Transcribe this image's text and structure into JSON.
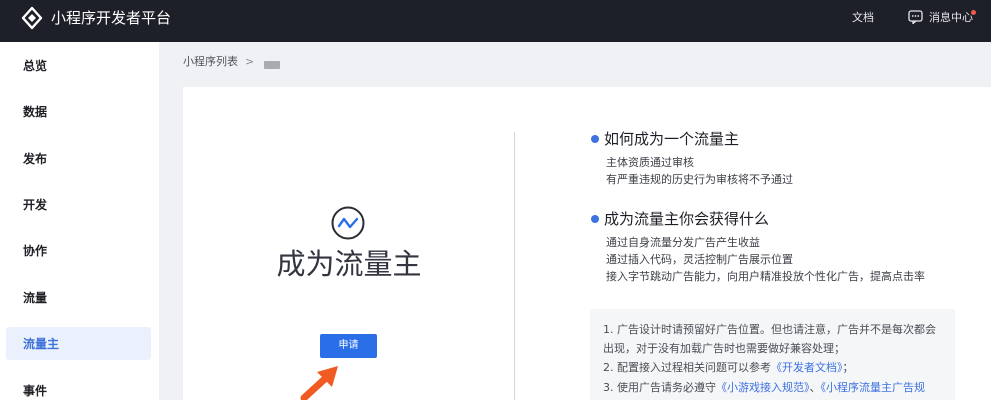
{
  "topbar": {
    "app_title": "小程序开发者平台",
    "doc_link": "文档",
    "messages_link": "消息中心"
  },
  "sidebar": {
    "items": [
      {
        "label": "总览"
      },
      {
        "label": "数据"
      },
      {
        "label": "发布"
      },
      {
        "label": "开发"
      },
      {
        "label": "协作"
      },
      {
        "label": "流量"
      },
      {
        "label": "流量主",
        "active": true
      },
      {
        "label": "事件"
      }
    ]
  },
  "breadcrumb": {
    "root": "小程序列表",
    "separator": ">"
  },
  "hero": {
    "title": "成为流量主",
    "apply_button": "申请"
  },
  "sections": [
    {
      "heading": "如何成为一个流量主",
      "lines": [
        "主体资质通过审核",
        "有严重违规的历史行为审核将不予通过"
      ]
    },
    {
      "heading": "成为流量主你会获得什么",
      "lines": [
        "通过自身流量分发广告产生收益",
        "通过插入代码，灵活控制广告展示位置",
        "接入字节跳动广告能力，向用户精准投放个性化广告，提高点击率"
      ]
    }
  ],
  "notes": {
    "line1": "1. 广告设计时请预留好广告位置。但也请注意，广告并不是每次都会",
    "line2": "出现，对于没有加载广告时也需要做好兼容处理；",
    "line3_prefix": "2. 配置接入过程相关问题可以参考",
    "line3_link": "《开发者文档》",
    "line3_suffix": "；",
    "line4_prefix": "3. 使用广告请务必遵守",
    "line4_link1": "《小游戏接入规范》",
    "line4_sep": "、",
    "line4_link2": "《小程序流量主广告规"
  },
  "colors": {
    "accent": "#2a6ee8",
    "topbar": "#1e2029",
    "sidebar_active_bg": "#eaf0fc",
    "sidebar_active_text": "#3e72d8",
    "arrow": "#f05b24",
    "notification_dot": "#f05a4a"
  },
  "icons": [
    "logo-icon",
    "message-icon",
    "trend-chart-icon",
    "pointer-arrow-icon"
  ]
}
